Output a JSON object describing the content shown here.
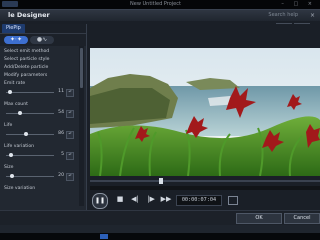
{
  "host": {
    "title": "New Untitled Project",
    "window_controls": "– □ ×"
  },
  "designer": {
    "title": "le Designer",
    "close_icon": "×",
    "help": "Search help"
  },
  "object_row": {
    "label": "de object"
  },
  "left_panel": {
    "tab_label": "PiePip",
    "menu_items": [
      "Select emit method",
      "Select particle style",
      "Add/Delete particle",
      "Modify parameters"
    ],
    "params": [
      {
        "label": "Emit rate",
        "value": "11",
        "slider_fraction": 0.08
      },
      {
        "label": "Max count",
        "value": "54",
        "slider_fraction": 0.3
      },
      {
        "label": "Life",
        "value": "86",
        "slider_fraction": 0.42
      },
      {
        "label": "Life variation",
        "value": "5",
        "slider_fraction": 0.1
      },
      {
        "label": "Size",
        "value": "20",
        "slider_fraction": 0.12
      },
      {
        "label": "Size variation",
        "value": "",
        "slider_fraction": 0.0
      }
    ]
  },
  "playback": {
    "timecode": "00:00:07:04",
    "play_icon": "pause-icon",
    "stop_icon": "stop-icon",
    "prev_icon": "prev-frame-icon",
    "next_icon": "next-frame-icon",
    "ff_icon": "fast-forward-icon",
    "progress_fraction": 0.31
  },
  "buttons": {
    "ok": "OK",
    "cancel": "Cancel"
  },
  "colors": {
    "accent": "#3d6fd0",
    "tab_active": "#1e3b6e"
  }
}
